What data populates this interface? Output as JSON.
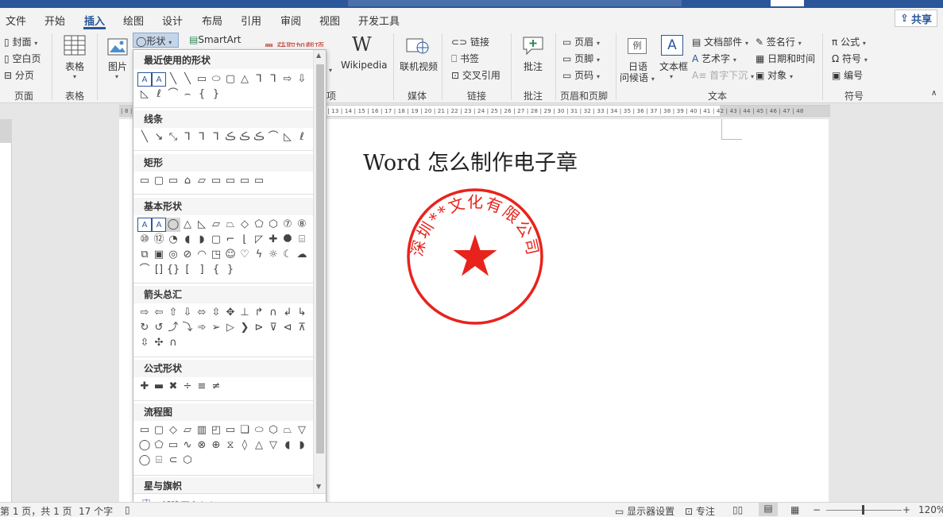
{
  "menu": {
    "items": [
      "文件",
      "开始",
      "插入",
      "绘图",
      "设计",
      "布局",
      "引用",
      "审阅",
      "视图",
      "开发工具"
    ],
    "active": "插入",
    "share_label": "共享"
  },
  "ribbon": {
    "pages": [
      "封面",
      "空白页",
      "分页"
    ],
    "pages_group": "页面",
    "table_label": "表格",
    "table_group": "表格",
    "picture_label": "图片",
    "shapes_label": "形状",
    "smartart_label": "SmartArt",
    "addins_partial": "获取加载项",
    "addins_group_partial": "项",
    "wikipedia_label": "Wikipedia",
    "video_label": "联机视频",
    "media_group": "媒体",
    "links": [
      "链接",
      "书签",
      "交叉引用"
    ],
    "links_group": "链接",
    "comment_label": "批注",
    "comment_group": "批注",
    "header_footer": [
      "页眉",
      "页脚",
      "页码"
    ],
    "header_footer_group": "页眉和页脚",
    "date_label_1": "日语",
    "date_label_2": "问候语",
    "textbox_label": "文本框",
    "text_items": [
      "文档部件",
      "艺术字",
      "首字下沉",
      "签名行",
      "日期和时间",
      "对象"
    ],
    "text_group": "文本",
    "symbol_items": [
      "公式",
      "符号",
      "编号"
    ],
    "symbol_group": "符号"
  },
  "ruler": {
    "numbers": "| 8 | 7 | 6 | 5 | 4 | 3 | 2 | 1 | | 1 | 2 | 3 | 4 | 5 | 6 | 7 | 8 | 9 | 10 | 11 | 12 | 13 | 14 | 15 | 16 | 17 | 18 | 19 | 20 | 21 | 22 | 23 | 24 | 25 | 26 | 27 | 28 | 29 | 30 | 31 | 32 | 33 | 34 | 35 | 36 | 37 | 38 | 39 | 40 | 41 | 42 | 43 | 44 | 45 | 46 | 47 | 48"
  },
  "document": {
    "title": "Word 怎么制作电子章",
    "seal_text": "深圳**文化有限公司",
    "seal_color": "#e8231c"
  },
  "shapes_menu": {
    "sections": [
      "最近使用的形状",
      "线条",
      "矩形",
      "基本形状",
      "箭头总汇",
      "公式形状",
      "流程图",
      "星与旗帜"
    ],
    "new_canvas": "新建画布(N)"
  },
  "status": {
    "page": "第 1 页，共 1 页",
    "words": "17 个字",
    "display_settings": "显示器设置",
    "focus": "专注",
    "zoom": "120%"
  }
}
